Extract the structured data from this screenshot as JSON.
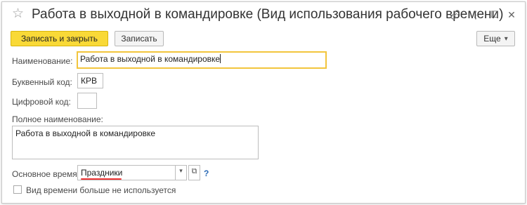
{
  "window": {
    "title": "Работа в выходной в командировке (Вид использования рабочего времени)"
  },
  "toolbar": {
    "save_close_label": "Записать и закрыть",
    "save_label": "Записать",
    "more_label": "Еще",
    "more_arrow": "▾"
  },
  "form": {
    "name_label": "Наименование:",
    "name_value": "Работа в выходной в командировке",
    "letter_code_label": "Буквенный код:",
    "letter_code_value": "КРВ",
    "digit_code_label": "Цифровой код:",
    "digit_code_value": "",
    "full_name_label": "Полное наименование:",
    "full_name_value": "Работа в выходной в командировке",
    "base_time_label": "Основное время:",
    "base_time_value": "Праздники",
    "base_time_dropdown": "▾",
    "base_time_open": "⧉",
    "base_time_help": "?",
    "obsolete_label": "Вид времени больше не используется"
  },
  "icons": {
    "star": "☆",
    "link": "🔗",
    "menu": "⋮",
    "maximize": "☐",
    "close": "✕"
  }
}
